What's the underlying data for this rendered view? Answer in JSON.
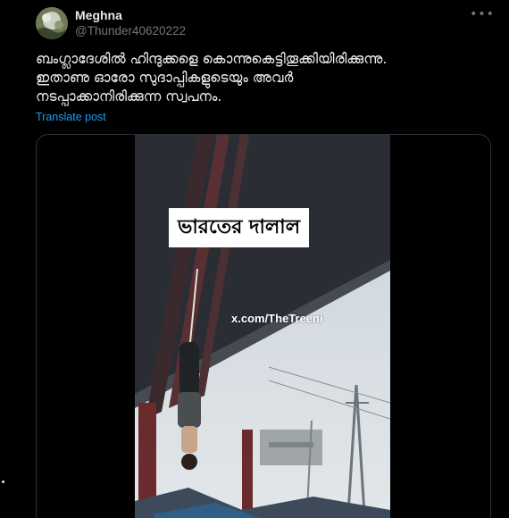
{
  "author": {
    "display_name": "Meghna",
    "handle": "@Thunder40620222",
    "avatar_icon": "profile-photo"
  },
  "menu": {
    "more_icon": "more-options-icon",
    "more_glyph": "•••"
  },
  "post": {
    "text_lines": [
      "ബംഗ്ലാദേശിൽ ഹിന്ദുക്കളെ കൊന്നുകെട്ടിതൂക്കിയിരിക്കുന്നു.",
      "ഇതാണു ഓരോ സുദാപ്പികളുടെയും അവർ",
      "നടപ്പാക്കാനിരിക്കുന്ന സ്വപനം."
    ],
    "translate_label": "Translate post"
  },
  "media": {
    "type": "video",
    "caption_text": "ভারতের দালাল",
    "watermark_text": "x.com/TheTreeni"
  },
  "colors": {
    "background": "#000000",
    "text_primary": "#e7e9ea",
    "text_secondary": "#71767b",
    "link": "#1d9bf0",
    "border": "#2f3336"
  }
}
